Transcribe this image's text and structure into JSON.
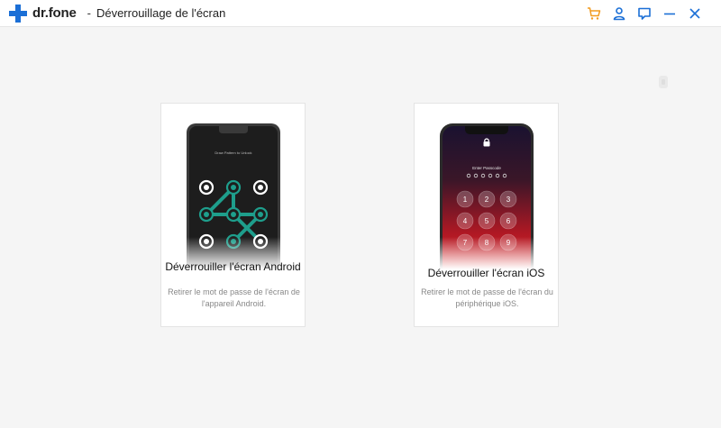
{
  "app": {
    "logo_text": "dr.fone",
    "separator": "-",
    "title": "Déverrouillage de l'écran"
  },
  "controls": {
    "icons": [
      "cart-icon",
      "user-icon",
      "feedback-icon",
      "minimize-icon",
      "close-icon"
    ],
    "cart_color": "#f29c1f",
    "accent_color": "#1b6fd6"
  },
  "cards": {
    "android": {
      "title": "Déverrouiller l'écran Android",
      "description": "Retirer le mot de passe de l'écran de l'appareil Android.",
      "screen_text": "Draw Pattern to Unlock"
    },
    "ios": {
      "title": "Déverrouiller l'écran iOS",
      "description": "Retirer le mot de passe de l'écran du périphérique iOS.",
      "screen_text": "Enter Passcode",
      "keys": [
        "1",
        "2",
        "3",
        "4",
        "5",
        "6",
        "7",
        "8",
        "9"
      ]
    }
  }
}
